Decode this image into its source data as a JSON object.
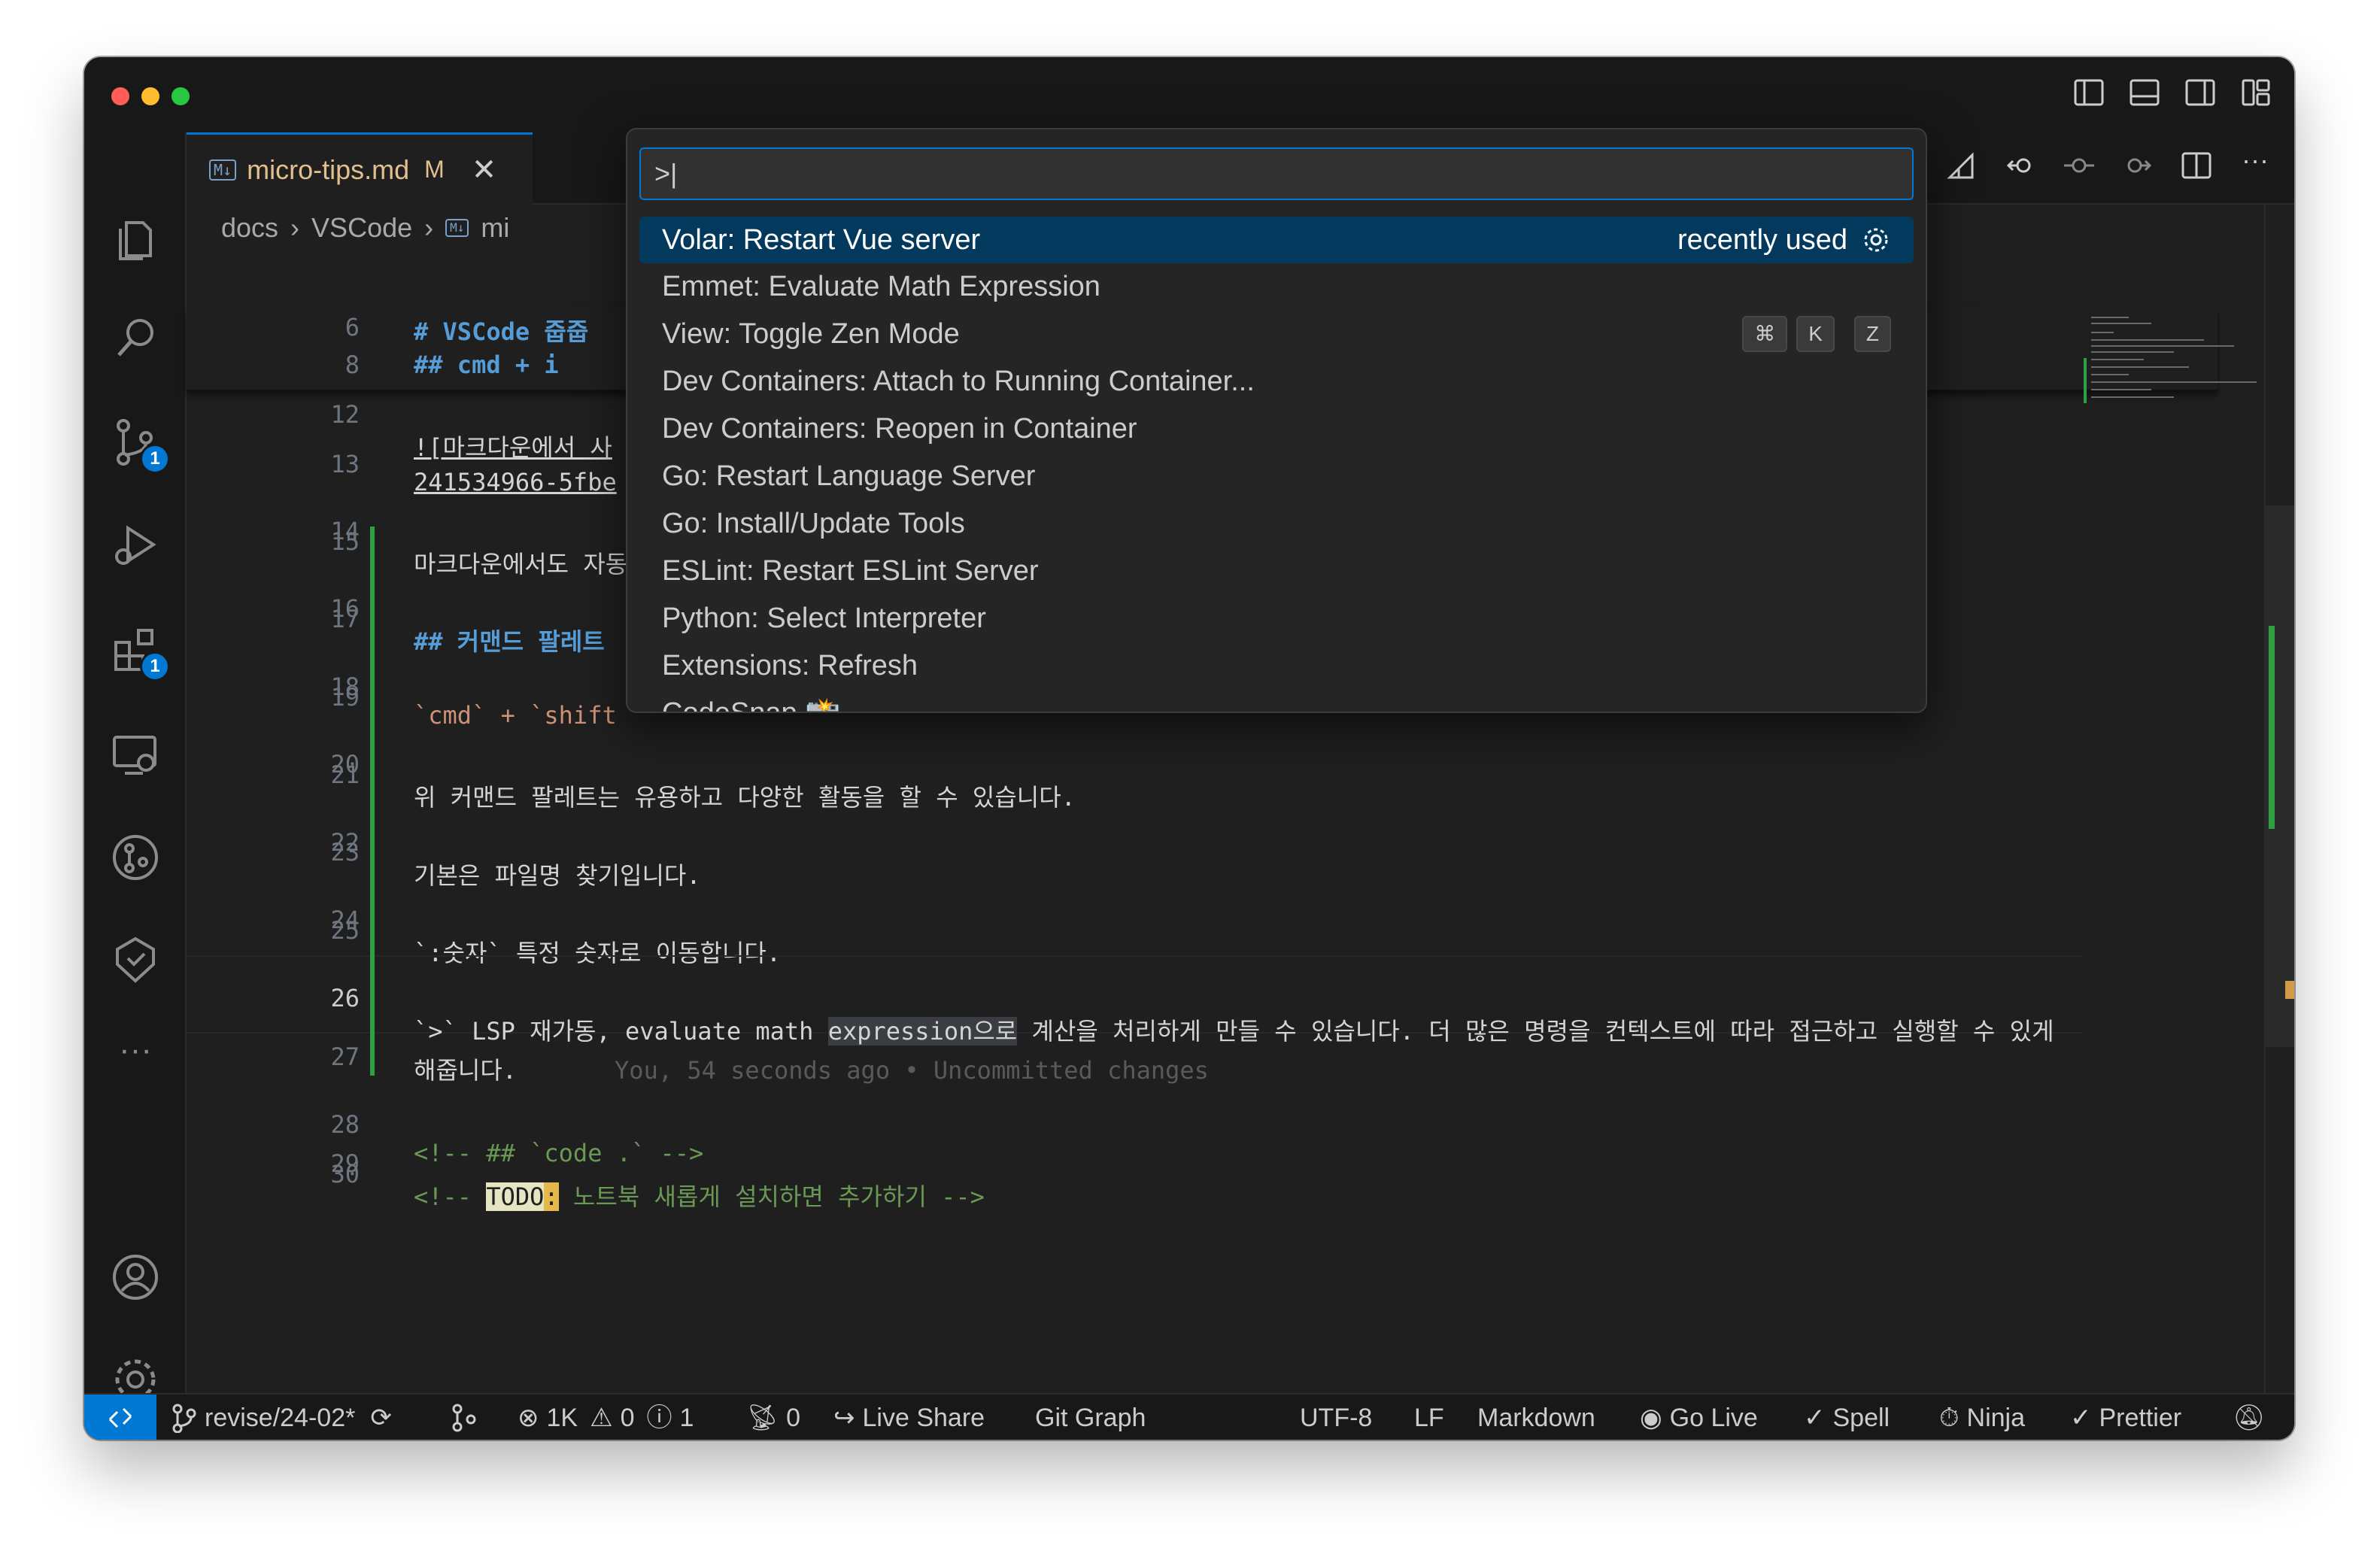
{
  "tab": {
    "title": "micro-tips.md",
    "modified": "M",
    "icon": "M↓"
  },
  "breadcrumb": [
    "docs",
    "VSCode",
    "mi"
  ],
  "activity_badges": {
    "scm": "1",
    "extensions": "1"
  },
  "editor": {
    "sticky": [
      {
        "num": "6",
        "text": "# VSCode 줍줍"
      },
      {
        "num": "8",
        "text": "## cmd + i"
      }
    ],
    "lines": [
      {
        "num": "12",
        "text": "![마크다운에서 사"
      },
      {
        "num": "",
        "text": "241534966-5fbe"
      },
      {
        "num": "13",
        "text": ""
      },
      {
        "num": "14",
        "text": "마크다운에서도 자동"
      },
      {
        "num": "15",
        "text": ""
      },
      {
        "num": "16",
        "text": "## 커맨드 팔레트"
      },
      {
        "num": "17",
        "text": ""
      },
      {
        "num": "18",
        "text": "`cmd` + `shift"
      },
      {
        "num": "19",
        "text": ""
      },
      {
        "num": "20",
        "text": "위 커맨드 팔레트는 유용하고 다양한 활동을 할 수 있습니다."
      },
      {
        "num": "21",
        "text": ""
      },
      {
        "num": "22",
        "text": "기본은 파일명 찾기입니다."
      },
      {
        "num": "23",
        "text": ""
      },
      {
        "num": "24",
        "text": "`:숫자` 특정 숫자로 이동합니다."
      },
      {
        "num": "25",
        "text": ""
      },
      {
        "num": "26",
        "text_pre": "`>` LSP 재가동, evaluate math ",
        "text_hl": "expression으로",
        "text_post": " 계산을 처리하게 만들 수 있습니다. 더 많은 명령을 컨텍스트에 따라 접근하고 실행할 수 있게"
      },
      {
        "num": "",
        "text": "해줍니다.",
        "blame": "You, 54 seconds ago • Uncommitted changes"
      },
      {
        "num": "27",
        "text": ""
      },
      {
        "num": "28",
        "text": "<!-- ## `code .` -->"
      },
      {
        "num": "29",
        "text_pre": "<!-- ",
        "todo": "TODO",
        "todo_colon": ":",
        "text_post": " 노트북 새롭게 설치하면 추가하기 -->"
      },
      {
        "num": "30",
        "text": ""
      }
    ]
  },
  "palette": {
    "input": ">|",
    "items": [
      {
        "label": "Volar: Restart Vue server",
        "hint": "recently used"
      },
      {
        "label": "Emmet: Evaluate Math Expression"
      },
      {
        "label": "View: Toggle Zen Mode",
        "keys": [
          "⌘",
          "K",
          "Z"
        ]
      },
      {
        "label": "Dev Containers: Attach to Running Container..."
      },
      {
        "label": "Dev Containers: Reopen in Container"
      },
      {
        "label": "Go: Restart Language Server"
      },
      {
        "label": "Go: Install/Update Tools"
      },
      {
        "label": "ESLint: Restart ESLint Server"
      },
      {
        "label": "Python: Select Interpreter"
      },
      {
        "label": "Extensions: Refresh"
      },
      {
        "label": "CodeSnap 📸"
      }
    ]
  },
  "status": {
    "branch": "revise/24-02*",
    "errors": "1K",
    "warnings": "0",
    "infos": "1",
    "ports": "0",
    "live_share": "Live Share",
    "git_graph": "Git Graph",
    "encoding": "UTF-8",
    "eol": "LF",
    "language": "Markdown",
    "go_live": "Go Live",
    "spell": "Spell",
    "ninja": "Ninja",
    "prettier": "Prettier"
  },
  "colors": {
    "accent": "#0078d4",
    "background": "#1f1f1f",
    "heading": "#569cd6",
    "comment": "#6a9955",
    "modified": "#e2c08d"
  }
}
